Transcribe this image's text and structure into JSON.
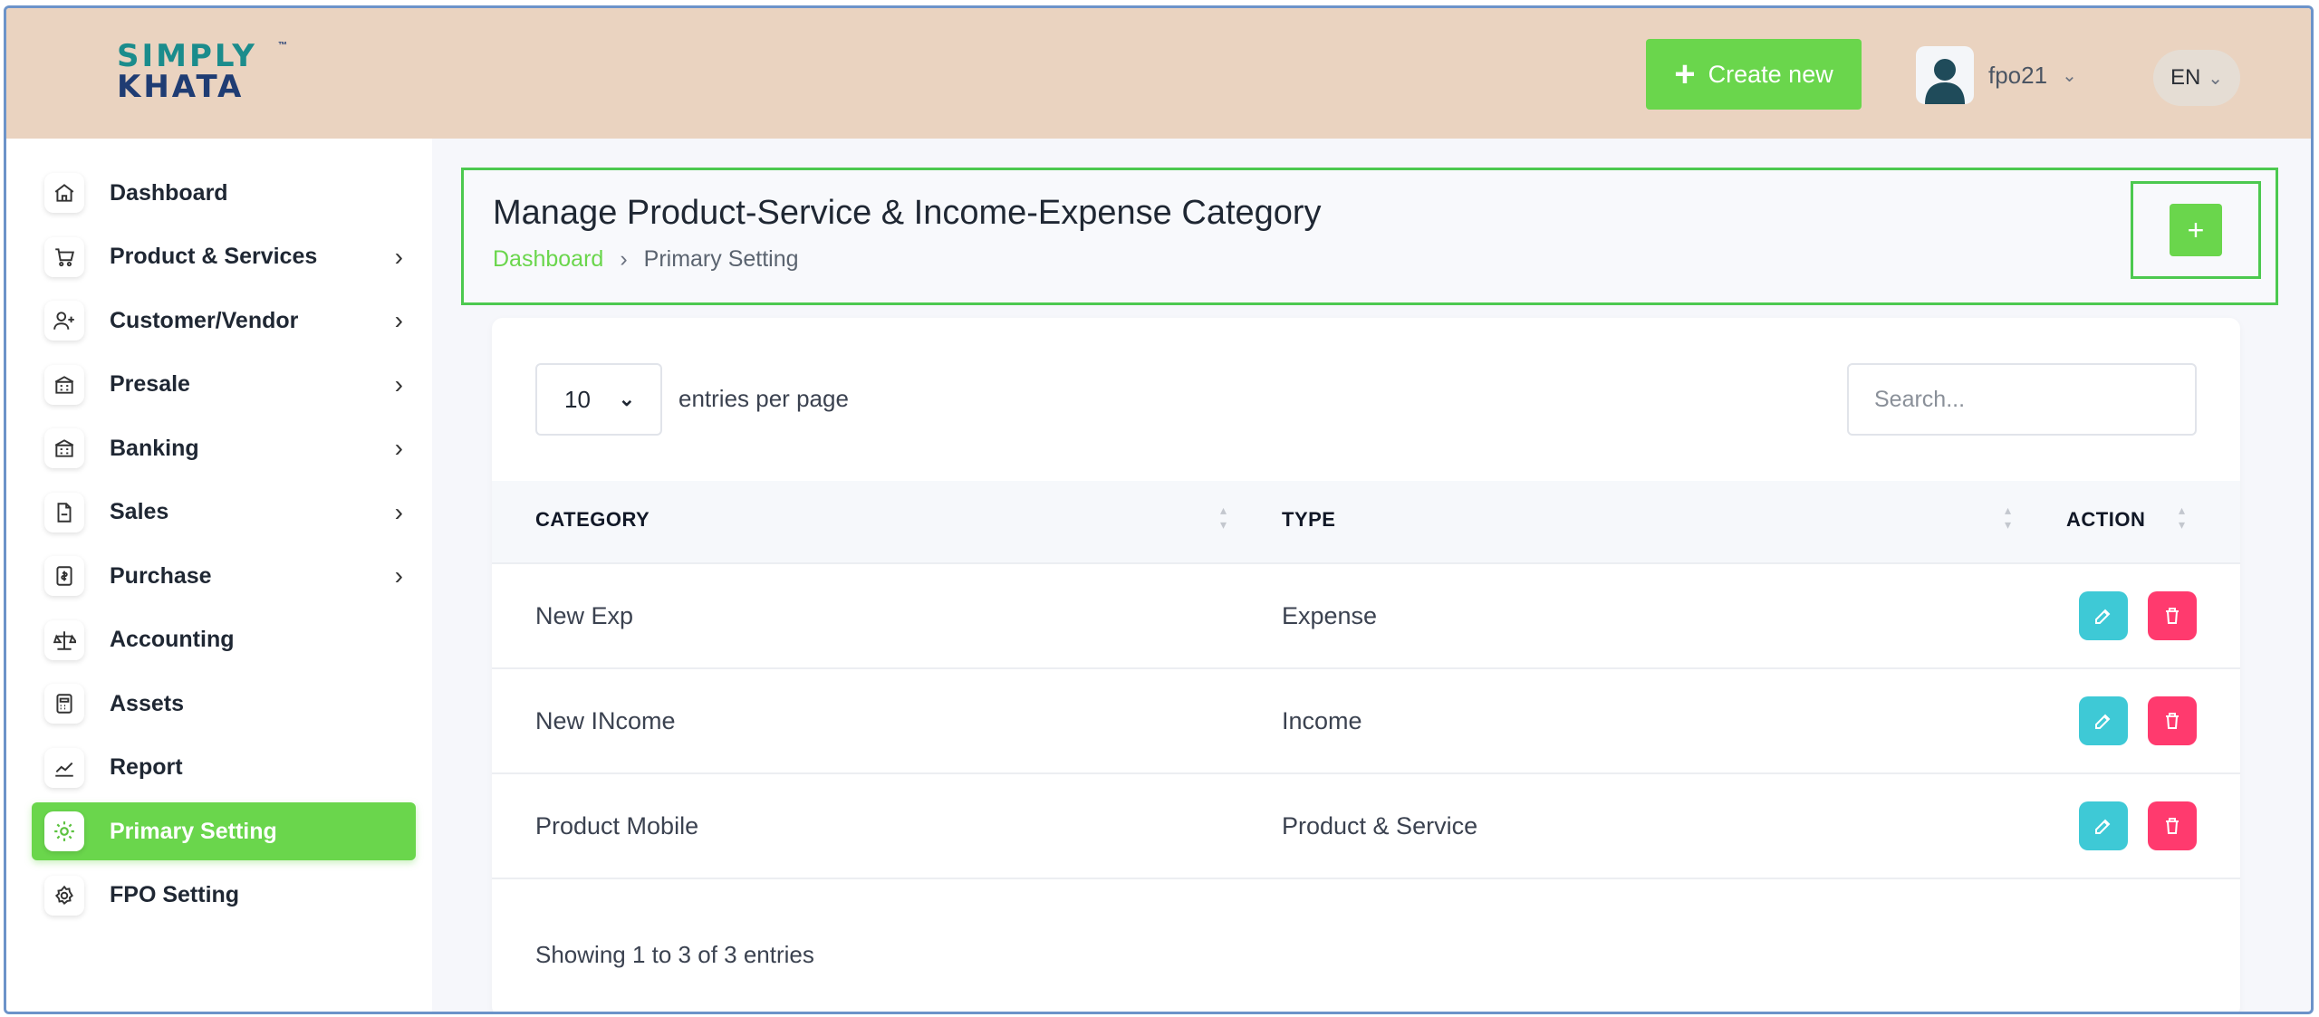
{
  "brand": {
    "line1": "SIMPLY",
    "line2": "KHATA",
    "tm": "™"
  },
  "header": {
    "create_label": "Create new",
    "create_icon": "plus-icon",
    "user_name": "fpo21",
    "lang": "EN"
  },
  "sidebar": {
    "items": [
      {
        "label": "Dashboard",
        "icon": "home-icon",
        "has_arrow": false,
        "active": false
      },
      {
        "label": "Product & Services",
        "icon": "cart-icon",
        "has_arrow": true,
        "active": false
      },
      {
        "label": "Customer/Vendor",
        "icon": "user-plus-icon",
        "has_arrow": true,
        "active": false
      },
      {
        "label": "Presale",
        "icon": "bank-icon",
        "has_arrow": true,
        "active": false
      },
      {
        "label": "Banking",
        "icon": "bank-icon",
        "has_arrow": true,
        "active": false
      },
      {
        "label": "Sales",
        "icon": "document-icon",
        "has_arrow": true,
        "active": false
      },
      {
        "label": "Purchase",
        "icon": "receipt-icon",
        "has_arrow": true,
        "active": false
      },
      {
        "label": "Accounting",
        "icon": "scale-icon",
        "has_arrow": false,
        "active": false
      },
      {
        "label": "Assets",
        "icon": "calculator-icon",
        "has_arrow": false,
        "active": false
      },
      {
        "label": "Report",
        "icon": "chart-line-icon",
        "has_arrow": false,
        "active": false
      },
      {
        "label": "Primary Setting",
        "icon": "settings-icon",
        "has_arrow": false,
        "active": true
      },
      {
        "label": "FPO Setting",
        "icon": "gear-icon",
        "has_arrow": false,
        "active": false
      }
    ]
  },
  "page": {
    "title": "Manage Product-Service & Income-Expense Category",
    "breadcrumb": [
      "Dashboard",
      "Primary Setting"
    ],
    "add_label": "+"
  },
  "table": {
    "per_page_value": "10",
    "per_page_label": "entries per page",
    "search_placeholder": "Search...",
    "columns": [
      "CATEGORY",
      "TYPE",
      "ACTION"
    ],
    "rows": [
      {
        "category": "New Exp",
        "type": "Expense"
      },
      {
        "category": "New INcome",
        "type": "Income"
      },
      {
        "category": "Product Mobile",
        "type": "Product & Service"
      }
    ],
    "info": "Showing 1 to 3 of 3 entries"
  },
  "colors": {
    "accent": "#6ad64c",
    "header_bg": "#ead3c0",
    "edit": "#3ec9d6",
    "delete": "#ff3a6e"
  }
}
